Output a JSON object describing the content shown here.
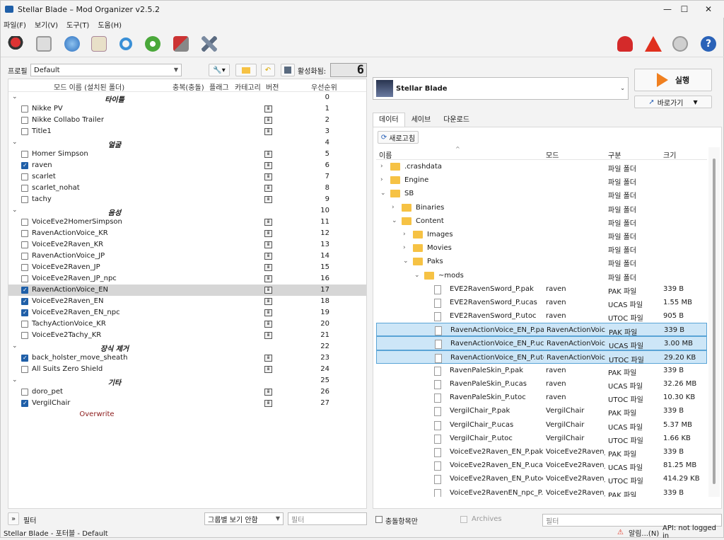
{
  "window": {
    "title": "Stellar Blade – Mod Organizer v2.5.2",
    "minimize": "—",
    "maximize": "☐",
    "close": "✕"
  },
  "menu": [
    "파일(F)",
    "보기(V)",
    "도구(T)",
    "도움(H)"
  ],
  "toolbar_icons": [
    "profile-icon",
    "install-mod-icon",
    "nexus-icon",
    "executables-icon",
    "refresh-icon",
    "plugins-icon",
    "tools-icon",
    "settings-icon",
    "endorse-icon",
    "warning-icon",
    "problems-icon",
    "help-icon"
  ],
  "left": {
    "profile_label": "프로필",
    "profile_value": "Default",
    "active_label": "활성화됨:",
    "active_count": "6",
    "headers": {
      "name": "모드 이름 (설치된 폴더)",
      "conflicts": "충복(충돌)",
      "flags": "플래그",
      "category": "카테고리",
      "version": "버전",
      "priority": "우선순위"
    },
    "rows": [
      {
        "type": "sep",
        "name": "타이틀",
        "priority": "0"
      },
      {
        "type": "mod",
        "name": "Nikke PV",
        "checked": false,
        "priority": "1"
      },
      {
        "type": "mod",
        "name": "Nikke Collabo Trailer",
        "checked": false,
        "priority": "2"
      },
      {
        "type": "mod",
        "name": "Title1",
        "checked": false,
        "priority": "3"
      },
      {
        "type": "sep",
        "name": "얼굴",
        "priority": "4"
      },
      {
        "type": "mod",
        "name": "Homer Simpson",
        "checked": false,
        "priority": "5"
      },
      {
        "type": "mod",
        "name": "raven",
        "checked": true,
        "priority": "6"
      },
      {
        "type": "mod",
        "name": "scarlet",
        "checked": false,
        "priority": "7"
      },
      {
        "type": "mod",
        "name": "scarlet_nohat",
        "checked": false,
        "priority": "8"
      },
      {
        "type": "mod",
        "name": "tachy",
        "checked": false,
        "priority": "9"
      },
      {
        "type": "sep",
        "name": "음성",
        "priority": "10"
      },
      {
        "type": "mod",
        "name": "VoiceEve2HomerSimpson",
        "checked": false,
        "priority": "11"
      },
      {
        "type": "mod",
        "name": "RavenActionVoice_KR",
        "checked": false,
        "priority": "12"
      },
      {
        "type": "mod",
        "name": "VoiceEve2Raven_KR",
        "checked": false,
        "priority": "13"
      },
      {
        "type": "mod",
        "name": "RavenActionVoice_JP",
        "checked": false,
        "priority": "14"
      },
      {
        "type": "mod",
        "name": "VoiceEve2Raven_JP",
        "checked": false,
        "priority": "15"
      },
      {
        "type": "mod",
        "name": "VoiceEve2Raven_JP_npc",
        "checked": false,
        "priority": "16"
      },
      {
        "type": "mod",
        "name": "RavenActionVoice_EN",
        "checked": true,
        "priority": "17",
        "selected": true
      },
      {
        "type": "mod",
        "name": "VoiceEve2Raven_EN",
        "checked": true,
        "priority": "18"
      },
      {
        "type": "mod",
        "name": "VoiceEve2Raven_EN_npc",
        "checked": true,
        "priority": "19"
      },
      {
        "type": "mod",
        "name": "TachyActionVoice_KR",
        "checked": false,
        "priority": "20"
      },
      {
        "type": "mod",
        "name": "VoiceEve2Tachy_KR",
        "checked": false,
        "priority": "21"
      },
      {
        "type": "sep",
        "name": "장식 제거",
        "priority": "22"
      },
      {
        "type": "mod",
        "name": "back_holster_move_sheath",
        "checked": true,
        "priority": "23"
      },
      {
        "type": "mod",
        "name": "All Suits Zero Shield",
        "checked": false,
        "priority": "24"
      },
      {
        "type": "sep",
        "name": "기타",
        "priority": "25"
      },
      {
        "type": "mod",
        "name": "doro_pet",
        "checked": false,
        "priority": "26"
      },
      {
        "type": "mod",
        "name": "VergilChair",
        "checked": true,
        "priority": "27"
      }
    ],
    "overwrite": "Overwrite",
    "filter_toggle": "»",
    "filter_label": "필터",
    "group_combo": "그룹별 보기 안함",
    "filter_placeholder": "필터"
  },
  "right": {
    "game_name": "Stellar Blade",
    "run_label": "실행",
    "shortcut_label": "바로가기",
    "tabs": [
      "데이터",
      "세이브",
      "다운로드"
    ],
    "refresh_label": "새로고침",
    "headers": {
      "name": "이름",
      "mod": "모드",
      "type": "구분",
      "size": "크기"
    },
    "rows": [
      {
        "depth": 0,
        "kind": "folder",
        "exp": "›",
        "name": ".crashdata",
        "mod": "",
        "type": "파일 폴더",
        "size": ""
      },
      {
        "depth": 0,
        "kind": "folder",
        "exp": "›",
        "name": "Engine",
        "mod": "",
        "type": "파일 폴더",
        "size": ""
      },
      {
        "depth": 0,
        "kind": "folder",
        "exp": "⌄",
        "name": "SB",
        "mod": "",
        "type": "파일 폴더",
        "size": ""
      },
      {
        "depth": 1,
        "kind": "folder",
        "exp": "›",
        "name": "Binaries",
        "mod": "",
        "type": "파일 폴더",
        "size": ""
      },
      {
        "depth": 1,
        "kind": "folder",
        "exp": "⌄",
        "name": "Content",
        "mod": "",
        "type": "파일 폴더",
        "size": ""
      },
      {
        "depth": 2,
        "kind": "folder",
        "exp": "›",
        "name": "Images",
        "mod": "",
        "type": "파일 폴더",
        "size": ""
      },
      {
        "depth": 2,
        "kind": "folder",
        "exp": "›",
        "name": "Movies",
        "mod": "",
        "type": "파일 폴더",
        "size": ""
      },
      {
        "depth": 2,
        "kind": "folder",
        "exp": "⌄",
        "name": "Paks",
        "mod": "",
        "type": "파일 폴더",
        "size": ""
      },
      {
        "depth": 3,
        "kind": "folder",
        "exp": "⌄",
        "name": "~mods",
        "mod": "",
        "type": "파일 폴더",
        "size": ""
      },
      {
        "depth": 4,
        "kind": "file",
        "exp": "",
        "name": "EVE2RavenSword_P.pak",
        "mod": "raven",
        "type": "PAK 파일",
        "size": "339 B"
      },
      {
        "depth": 4,
        "kind": "file",
        "exp": "",
        "name": "EVE2RavenSword_P.ucas",
        "mod": "raven",
        "type": "UCAS 파일",
        "size": "1.55 MB"
      },
      {
        "depth": 4,
        "kind": "file",
        "exp": "",
        "name": "EVE2RavenSword_P.utoc",
        "mod": "raven",
        "type": "UTOC 파일",
        "size": "905 B"
      },
      {
        "depth": 4,
        "kind": "file",
        "exp": "",
        "name": "RavenActionVoice_EN_P.pak",
        "mod": "RavenActionVoic...",
        "type": "PAK 파일",
        "size": "339 B",
        "hl": true
      },
      {
        "depth": 4,
        "kind": "file",
        "exp": "",
        "name": "RavenActionVoice_EN_P.ucas",
        "mod": "RavenActionVoic...",
        "type": "UCAS 파일",
        "size": "3.00 MB",
        "hl": true
      },
      {
        "depth": 4,
        "kind": "file",
        "exp": "",
        "name": "RavenActionVoice_EN_P.utoc",
        "mod": "RavenActionVoic...",
        "type": "UTOC 파일",
        "size": "29.20 KB",
        "hl": true
      },
      {
        "depth": 4,
        "kind": "file",
        "exp": "",
        "name": "RavenPaleSkin_P.pak",
        "mod": "raven",
        "type": "PAK 파일",
        "size": "339 B"
      },
      {
        "depth": 4,
        "kind": "file",
        "exp": "",
        "name": "RavenPaleSkin_P.ucas",
        "mod": "raven",
        "type": "UCAS 파일",
        "size": "32.26 MB"
      },
      {
        "depth": 4,
        "kind": "file",
        "exp": "",
        "name": "RavenPaleSkin_P.utoc",
        "mod": "raven",
        "type": "UTOC 파일",
        "size": "10.30 KB"
      },
      {
        "depth": 4,
        "kind": "file",
        "exp": "",
        "name": "VergilChair_P.pak",
        "mod": "VergilChair",
        "type": "PAK 파일",
        "size": "339 B"
      },
      {
        "depth": 4,
        "kind": "file",
        "exp": "",
        "name": "VergilChair_P.ucas",
        "mod": "VergilChair",
        "type": "UCAS 파일",
        "size": "5.37 MB"
      },
      {
        "depth": 4,
        "kind": "file",
        "exp": "",
        "name": "VergilChair_P.utoc",
        "mod": "VergilChair",
        "type": "UTOC 파일",
        "size": "1.66 KB"
      },
      {
        "depth": 4,
        "kind": "file",
        "exp": "",
        "name": "VoiceEve2Raven_EN_P.pak",
        "mod": "VoiceEve2Raven_...",
        "type": "PAK 파일",
        "size": "339 B"
      },
      {
        "depth": 4,
        "kind": "file",
        "exp": "",
        "name": "VoiceEve2Raven_EN_P.ucas",
        "mod": "VoiceEve2Raven_...",
        "type": "UCAS 파일",
        "size": "81.25 MB"
      },
      {
        "depth": 4,
        "kind": "file",
        "exp": "",
        "name": "VoiceEve2Raven_EN_P.utoc",
        "mod": "VoiceEve2Raven_...",
        "type": "UTOC 파일",
        "size": "414.29 KB"
      },
      {
        "depth": 4,
        "kind": "file",
        "exp": "",
        "name": "VoiceEve2RavenEN_npc_P.pak",
        "mod": "VoiceEve2Raven_...",
        "type": "PAK 파일",
        "size": "339 B"
      }
    ],
    "conflicts_only": "충돌항목만",
    "archives": "Archives",
    "filter_placeholder": "필터"
  },
  "status": {
    "left": "Stellar Blade - 포터블 - Default",
    "notify": "알림...(N)",
    "api": "API: not logged in"
  },
  "colors": {
    "accent": "#1f5fa8",
    "highlight": "#cde6f7",
    "overwrite": "#8b1a1a"
  }
}
